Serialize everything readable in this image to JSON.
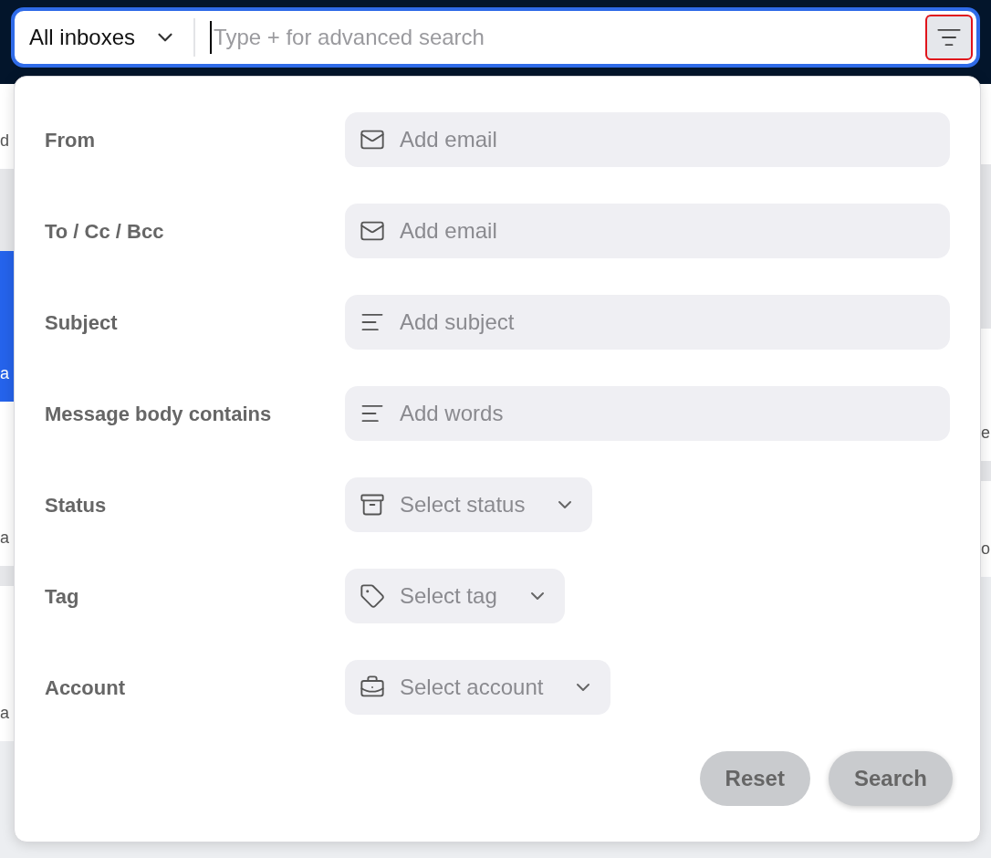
{
  "background": {
    "left_fragments": [
      "d",
      "a",
      "a",
      "a"
    ],
    "right_fragments": [
      "e",
      "o"
    ]
  },
  "search_bar": {
    "scope": "All inboxes",
    "placeholder": "Type + for advanced search",
    "filter_highlighted": true
  },
  "fields": [
    {
      "kind": "email",
      "label": "From",
      "placeholder": "Add email"
    },
    {
      "kind": "email",
      "label": "To / Cc / Bcc",
      "placeholder": "Add email"
    },
    {
      "kind": "text",
      "label": "Subject",
      "placeholder": "Add subject"
    },
    {
      "kind": "text",
      "label": "Message body contains",
      "placeholder": "Add words"
    },
    {
      "kind": "status",
      "label": "Status",
      "placeholder": "Select status"
    },
    {
      "kind": "tag",
      "label": "Tag",
      "placeholder": "Select tag"
    },
    {
      "kind": "account",
      "label": "Account",
      "placeholder": "Select account"
    }
  ],
  "buttons": [
    "Reset",
    "Search"
  ]
}
